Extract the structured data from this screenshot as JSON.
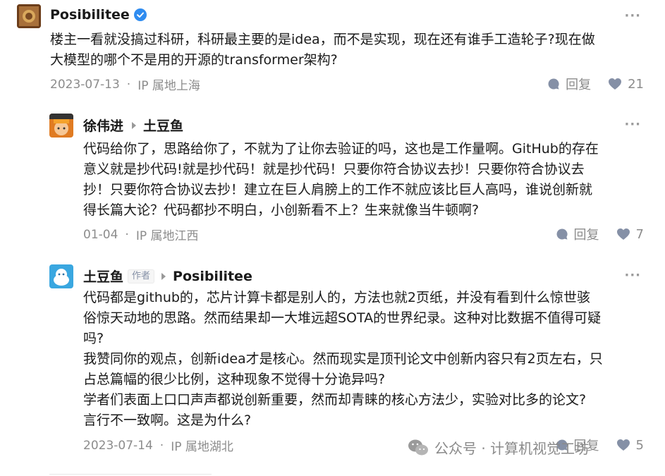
{
  "comments": [
    {
      "user": "Posibilitee",
      "text_lines": [
        "楼主一看就没搞过科研，科研最主要的是idea，而不是实现，现在还有谁手工造轮子?现在做",
        "大模型的哪个不是用的开源的transformer架构?"
      ],
      "date": "2023-07-13",
      "ip": "IP 属地上海",
      "reply_label": "回复",
      "likes": "21"
    },
    {
      "user": "徐伟进",
      "reply_to": "土豆鱼",
      "text_lines": [
        "代码给你了，思路给你了，不就为了让你去验证的吗，这也是工作量啊。GitHub的存在",
        "意义就是抄代码!就是抄代码！就是抄代码！只要你符合协议去抄！只要你符合协议去",
        "抄！只要你符合协议去抄！建立在巨人肩膀上的工作不就应该比巨人高吗，谁说创新就",
        "得长篇大论？代码都抄不明白，小创新看不上？生来就像当牛顿啊?"
      ],
      "date": "01-04",
      "ip": "IP 属地江西",
      "reply_label": "回复",
      "likes": "7"
    },
    {
      "user": "土豆鱼",
      "author_tag": "作者",
      "reply_to": "Posibilitee",
      "text_lines": [
        "代码都是github的，芯片计算卡都是别人的，方法也就2页纸，并没有看到什么惊世骇",
        "俗惊天动地的思路。然而结果却一大堆远超SOTA的世界纪录。这种对比数据不值得可疑",
        "吗?",
        "我赞同你的观点，创新idea才是核心。然而现实是顶刊论文中创新内容只有2页左右，只",
        "占总篇幅的很少比例，这种现象不觉得十分诡异吗?",
        "学者们表面上口口声声都说创新重要，然而却青睐的核心方法少，实验对比多的论文?",
        "言行不一致啊。这是为什么?"
      ],
      "date": "2023-07-14",
      "ip": "IP 属地湖北",
      "reply_label": "回复",
      "likes": "5"
    }
  ],
  "more_label": "···",
  "dot": "·",
  "watermark": "公众号 · 计算机视觉工坊",
  "colors": {
    "meta": "#8c8c8c",
    "verified": "#2f8cf0"
  }
}
